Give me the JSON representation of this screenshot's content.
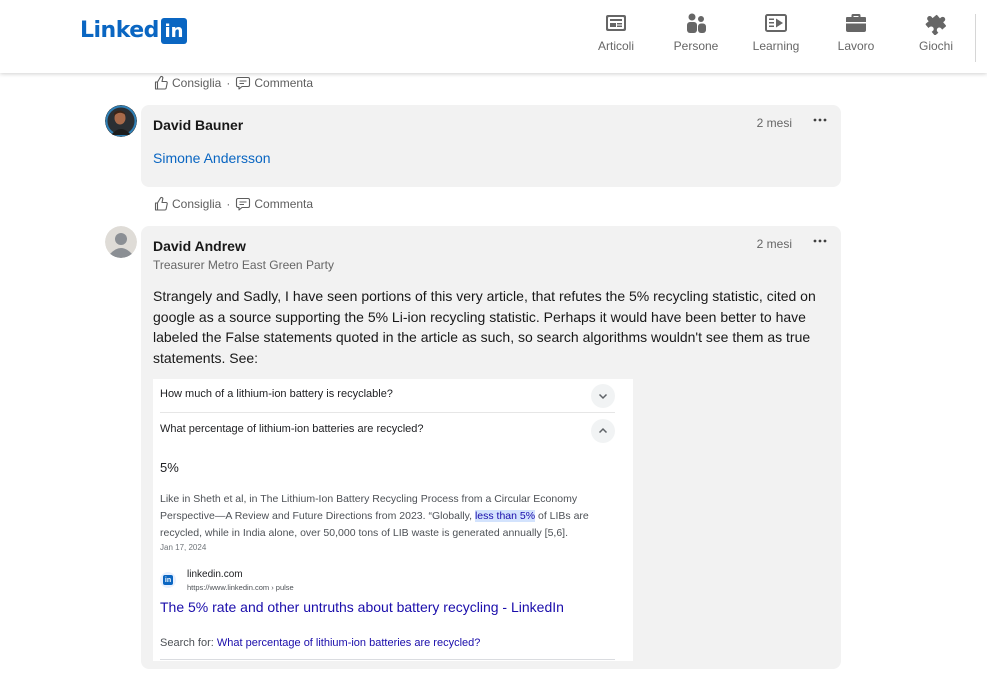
{
  "brand": {
    "logo_text": "Linked",
    "logo_box": "in",
    "color": "#0a66c2"
  },
  "nav": {
    "items": [
      {
        "label": "Articoli",
        "icon": "articles-icon"
      },
      {
        "label": "Persone",
        "icon": "people-icon"
      },
      {
        "label": "Learning",
        "icon": "learning-icon"
      },
      {
        "label": "Lavoro",
        "icon": "briefcase-icon"
      },
      {
        "label": "Giochi",
        "icon": "puzzle-icon"
      }
    ]
  },
  "actions": {
    "like": "Consiglia",
    "separator": "·",
    "comment": "Commenta"
  },
  "comments": [
    {
      "author": "David Bauner",
      "time": "2 mesi",
      "mention": "Simone Andersson"
    },
    {
      "author": "David Andrew",
      "headline": "Treasurer Metro East Green Party",
      "time": "2 mesi",
      "text": "Strangely and Sadly, I have seen portions of this very article, that refutes the 5% recycling statistic, cited on google as a source supporting the 5% Li-ion recycling statistic.   Perhaps it would have been better to have labeled the False statements quoted in the article as such, so search algorithms wouldn't see them as true statements.   See:",
      "screenshot": {
        "question_1": "How much of a lithium-ion battery is recyclable?",
        "question_2": "What percentage of lithium-ion batteries are recycled?",
        "answer": "5%",
        "snippet_before": "Like in Sheth et al, in The Lithium-Ion Battery Recycling Process from a Circular Economy Perspective—A Review and Future Directions from 2023. “Globally, ",
        "snippet_highlight": "less than 5%",
        "snippet_after": " of LIBs are recycled, while in India alone, over 50,000 tons of LIB waste is generated annually [5,6].",
        "date": "Jan 17, 2024",
        "source_name": "linkedin.com",
        "source_url": "https://www.linkedin.com › pulse",
        "result_title": "The 5% rate and other untruths about battery recycling - LinkedIn",
        "search_for_label": "Search for: ",
        "search_for_link": "What percentage of lithium-ion batteries are recycled?"
      }
    }
  ]
}
